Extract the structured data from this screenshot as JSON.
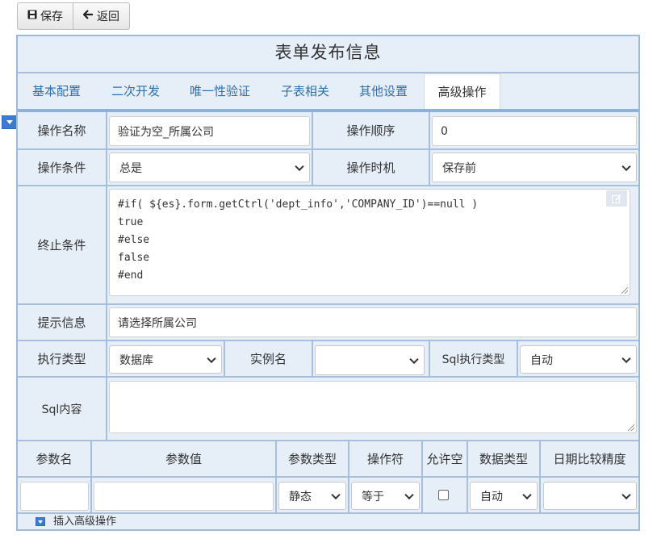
{
  "toolbar": {
    "save_label": "保存",
    "back_label": "返回"
  },
  "form": {
    "title": "表单发布信息"
  },
  "tabs": [
    {
      "label": "基本配置"
    },
    {
      "label": "二次开发"
    },
    {
      "label": "唯一性验证"
    },
    {
      "label": "子表相关"
    },
    {
      "label": "其他设置"
    },
    {
      "label": "高级操作",
      "active": true
    }
  ],
  "fields": {
    "op_name_label": "操作名称",
    "op_name_value": "验证为空_所属公司",
    "op_order_label": "操作顺序",
    "op_order_value": "0",
    "op_condition_label": "操作条件",
    "op_condition_value": "总是",
    "op_timing_label": "操作时机",
    "op_timing_value": "保存前",
    "stop_condition_label": "终止条件",
    "stop_condition_value": "#if( ${es}.form.getCtrl('dept_info','COMPANY_ID')==null )\ntrue\n#else\nfalse\n#end",
    "hint_label": "提示信息",
    "hint_value": "请选择所属公司",
    "exec_type_label": "执行类型",
    "exec_type_value": "数据库",
    "instance_label": "实例名",
    "instance_value": "",
    "sql_exec_type_label": "Sql执行类型",
    "sql_exec_type_value": "自动",
    "sql_content_label": "Sql内容",
    "sql_content_value": ""
  },
  "params": {
    "headers": [
      "参数名",
      "参数值",
      "参数类型",
      "操作符",
      "允许空",
      "数据类型",
      "日期比较精度"
    ],
    "row": {
      "name": "",
      "value": "",
      "type": "静态",
      "operator": "等于",
      "allow_null": false,
      "data_type": "自动",
      "date_precision": ""
    }
  },
  "insert_label": "插入高级操作",
  "colors": {
    "border": "#a7bedc",
    "panel": "#e6eef8",
    "tab_text": "#2f6fa7",
    "accent": "#3b7bd0"
  }
}
